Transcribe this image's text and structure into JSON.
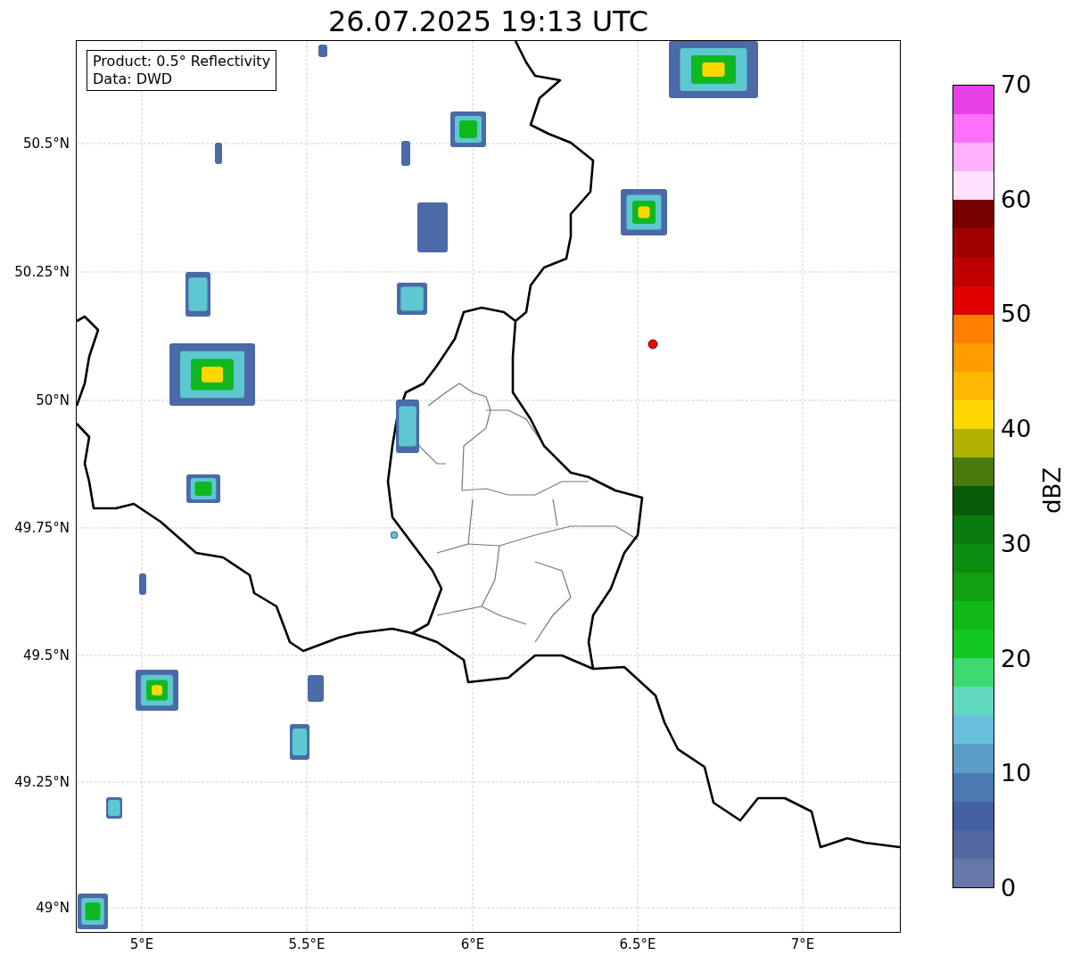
{
  "title": "26.07.2025 19:13 UTC",
  "legend": [
    "Product: 0.5° Reflectivity",
    "Data: DWD"
  ],
  "y_ticks": [
    "50.5°N",
    "50.25°N",
    "50°N",
    "49.75°N",
    "49.5°N",
    "49.25°N",
    "49°N"
  ],
  "x_ticks": [
    "5°E",
    "5.5°E",
    "6°E",
    "6.5°E",
    "7°E"
  ],
  "colorbar": {
    "label": "dBZ",
    "ticks": [
      "70",
      "60",
      "50",
      "40",
      "30",
      "20",
      "10",
      "0"
    ],
    "bands": [
      {
        "color": "#6677a8"
      },
      {
        "color": "#5468a0"
      },
      {
        "color": "#4560a5"
      },
      {
        "color": "#4a78b0"
      },
      {
        "color": "#5a9ec8"
      },
      {
        "color": "#68c0dc"
      },
      {
        "color": "#60d8c0"
      },
      {
        "color": "#3dd870"
      },
      {
        "color": "#10c820"
      },
      {
        "color": "#10b818"
      },
      {
        "color": "#10a010"
      },
      {
        "color": "#0c8c10"
      },
      {
        "color": "#0a7a10"
      },
      {
        "color": "#085a08"
      },
      {
        "color": "#4a7a0a"
      },
      {
        "color": "#b0b000"
      },
      {
        "color": "#ffd700"
      },
      {
        "color": "#ffb800"
      },
      {
        "color": "#ff9c00"
      },
      {
        "color": "#ff7f00"
      },
      {
        "color": "#e00000"
      },
      {
        "color": "#c00000"
      },
      {
        "color": "#a00000"
      },
      {
        "color": "#780000"
      },
      {
        "color": "#ffe0ff"
      },
      {
        "color": "#ffb0ff"
      },
      {
        "color": "#ff70ff"
      },
      {
        "color": "#e840e8"
      }
    ]
  }
}
